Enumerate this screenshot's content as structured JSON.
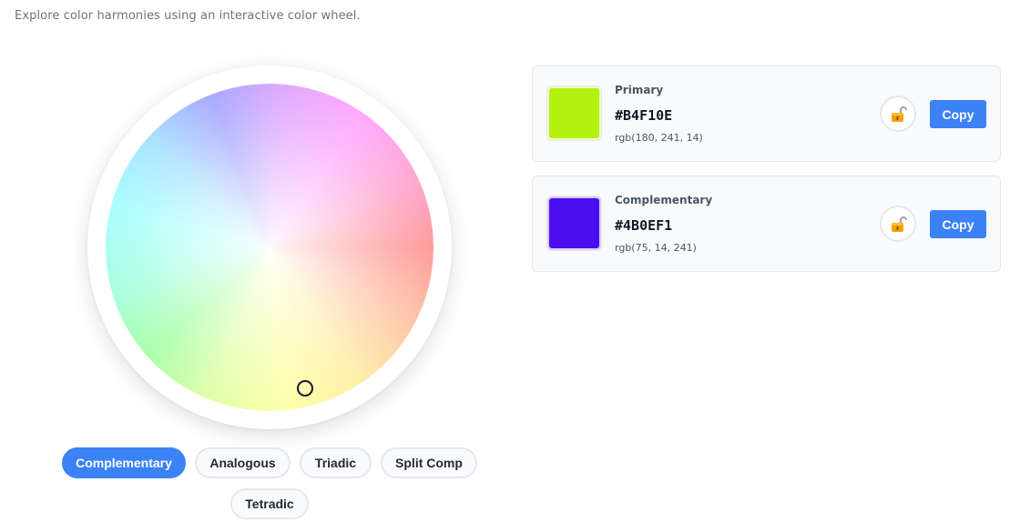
{
  "subtitle": "Explore color harmonies using an interactive color wheel.",
  "wheel": {
    "handle_icon": "circle-handle"
  },
  "modes": [
    {
      "label": "Complementary",
      "active": true
    },
    {
      "label": "Analogous",
      "active": false
    },
    {
      "label": "Triadic",
      "active": false
    },
    {
      "label": "Split Comp",
      "active": false
    },
    {
      "label": "Tetradic",
      "active": false
    }
  ],
  "colors": [
    {
      "label": "Primary",
      "hex": "#B4F10E",
      "rgb": "rgb(180, 241, 14)",
      "swatch": "#B4F10E",
      "lock_icon": "unlocked-padlock-icon",
      "copy_label": "Copy"
    },
    {
      "label": "Complementary",
      "hex": "#4B0EF1",
      "rgb": "rgb(75, 14, 241)",
      "swatch": "#4B0EF1",
      "lock_icon": "unlocked-padlock-icon",
      "copy_label": "Copy"
    }
  ],
  "accent": "#3B82F6"
}
